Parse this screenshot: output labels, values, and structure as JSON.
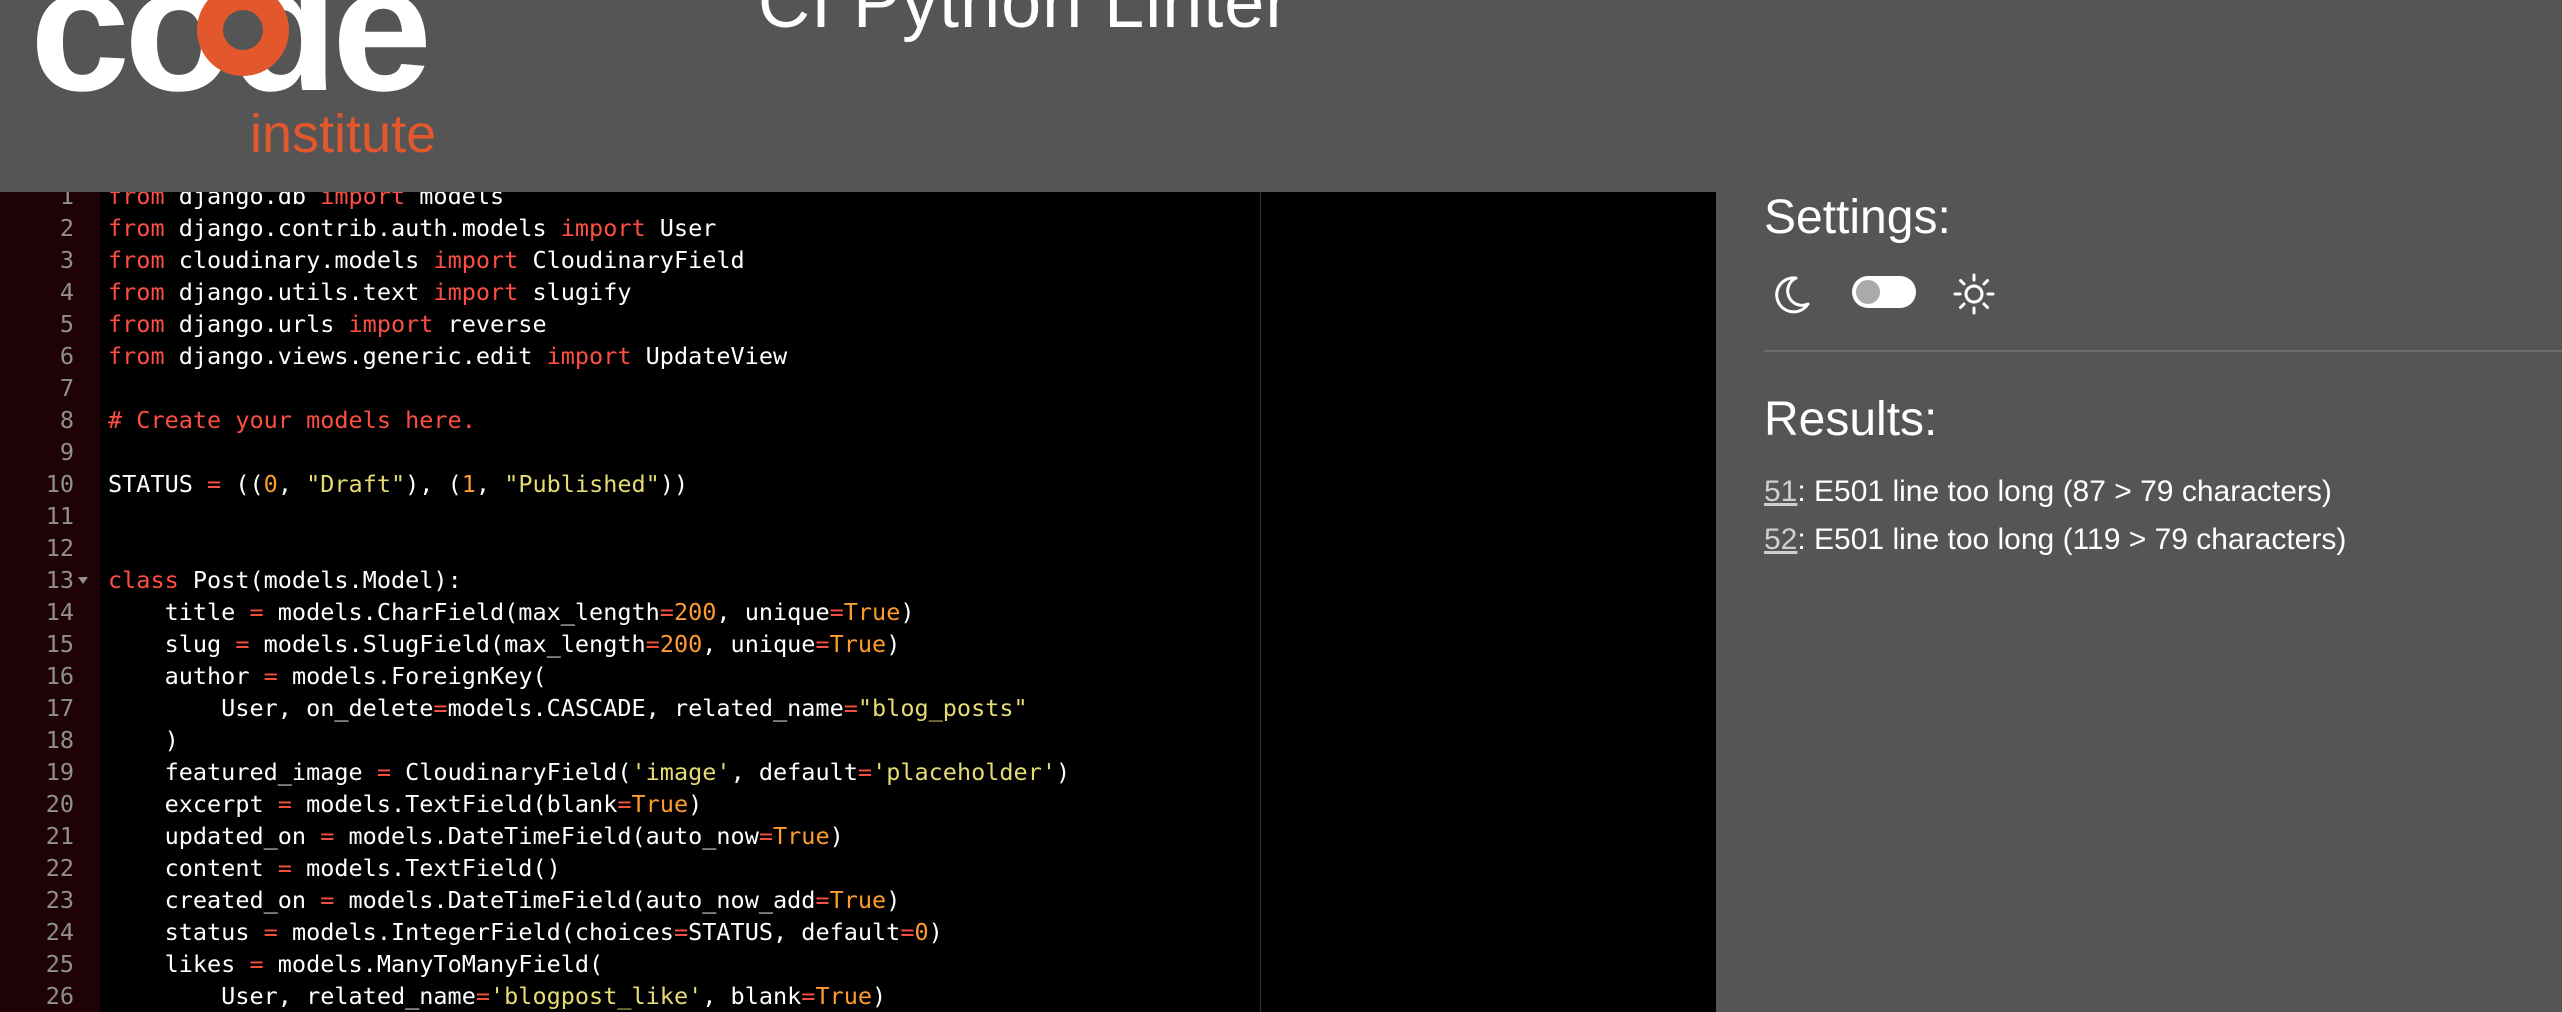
{
  "header": {
    "logo_main": "code",
    "logo_sub": "institute",
    "title": "CI Python Linter"
  },
  "editor": {
    "lines": [
      {
        "n": "1",
        "tokens": [
          [
            "kw",
            "from"
          ],
          [
            "t",
            " django.db "
          ],
          [
            "kw",
            "import"
          ],
          [
            "t",
            " models"
          ]
        ]
      },
      {
        "n": "2",
        "tokens": [
          [
            "kw",
            "from"
          ],
          [
            "t",
            " django.contrib.auth.models "
          ],
          [
            "kw",
            "import"
          ],
          [
            "t",
            " User"
          ]
        ]
      },
      {
        "n": "3",
        "tokens": [
          [
            "kw",
            "from"
          ],
          [
            "t",
            " cloudinary.models "
          ],
          [
            "kw",
            "import"
          ],
          [
            "t",
            " CloudinaryField"
          ]
        ]
      },
      {
        "n": "4",
        "tokens": [
          [
            "kw",
            "from"
          ],
          [
            "t",
            " django.utils.text "
          ],
          [
            "kw",
            "import"
          ],
          [
            "t",
            " slugify"
          ]
        ]
      },
      {
        "n": "5",
        "tokens": [
          [
            "kw",
            "from"
          ],
          [
            "t",
            " django.urls "
          ],
          [
            "kw",
            "import"
          ],
          [
            "t",
            " reverse"
          ]
        ]
      },
      {
        "n": "6",
        "tokens": [
          [
            "kw",
            "from"
          ],
          [
            "t",
            " django.views.generic.edit "
          ],
          [
            "kw",
            "import"
          ],
          [
            "t",
            " UpdateView"
          ]
        ]
      },
      {
        "n": "7",
        "tokens": []
      },
      {
        "n": "8",
        "tokens": [
          [
            "cm",
            "# Create your models here."
          ]
        ]
      },
      {
        "n": "9",
        "tokens": []
      },
      {
        "n": "10",
        "tokens": [
          [
            "t",
            "STATUS "
          ],
          [
            "op",
            "="
          ],
          [
            "t",
            " (("
          ],
          [
            "num",
            "0"
          ],
          [
            "t",
            ", "
          ],
          [
            "str",
            "\"Draft\""
          ],
          [
            "t",
            "), ("
          ],
          [
            "num",
            "1"
          ],
          [
            "t",
            ", "
          ],
          [
            "str",
            "\"Published\""
          ],
          [
            "t",
            "))"
          ]
        ]
      },
      {
        "n": "11",
        "tokens": []
      },
      {
        "n": "12",
        "tokens": []
      },
      {
        "n": "13",
        "fold": true,
        "tokens": [
          [
            "kw",
            "class"
          ],
          [
            "t",
            " Post(models.Model):"
          ]
        ]
      },
      {
        "n": "14",
        "tokens": [
          [
            "t",
            "    title "
          ],
          [
            "op",
            "="
          ],
          [
            "t",
            " models.CharField(max_length"
          ],
          [
            "op",
            "="
          ],
          [
            "num",
            "200"
          ],
          [
            "t",
            ", unique"
          ],
          [
            "op",
            "="
          ],
          [
            "num",
            "True"
          ],
          [
            "t",
            ")"
          ]
        ]
      },
      {
        "n": "15",
        "tokens": [
          [
            "t",
            "    slug "
          ],
          [
            "op",
            "="
          ],
          [
            "t",
            " models.SlugField(max_length"
          ],
          [
            "op",
            "="
          ],
          [
            "num",
            "200"
          ],
          [
            "t",
            ", unique"
          ],
          [
            "op",
            "="
          ],
          [
            "num",
            "True"
          ],
          [
            "t",
            ")"
          ]
        ]
      },
      {
        "n": "16",
        "tokens": [
          [
            "t",
            "    author "
          ],
          [
            "op",
            "="
          ],
          [
            "t",
            " models.ForeignKey("
          ]
        ]
      },
      {
        "n": "17",
        "tokens": [
          [
            "t",
            "        User, on_delete"
          ],
          [
            "op",
            "="
          ],
          [
            "t",
            "models.CASCADE, related_name"
          ],
          [
            "op",
            "="
          ],
          [
            "str",
            "\"blog_posts\""
          ]
        ]
      },
      {
        "n": "18",
        "tokens": [
          [
            "t",
            "    )"
          ]
        ]
      },
      {
        "n": "19",
        "tokens": [
          [
            "t",
            "    featured_image "
          ],
          [
            "op",
            "="
          ],
          [
            "t",
            " CloudinaryField("
          ],
          [
            "str",
            "'image'"
          ],
          [
            "t",
            ", default"
          ],
          [
            "op",
            "="
          ],
          [
            "str",
            "'placeholder'"
          ],
          [
            "t",
            ")"
          ]
        ]
      },
      {
        "n": "20",
        "tokens": [
          [
            "t",
            "    excerpt "
          ],
          [
            "op",
            "="
          ],
          [
            "t",
            " models.TextField(blank"
          ],
          [
            "op",
            "="
          ],
          [
            "num",
            "True"
          ],
          [
            "t",
            ")"
          ]
        ]
      },
      {
        "n": "21",
        "tokens": [
          [
            "t",
            "    updated_on "
          ],
          [
            "op",
            "="
          ],
          [
            "t",
            " models.DateTimeField(auto_now"
          ],
          [
            "op",
            "="
          ],
          [
            "num",
            "True"
          ],
          [
            "t",
            ")"
          ]
        ]
      },
      {
        "n": "22",
        "tokens": [
          [
            "t",
            "    content "
          ],
          [
            "op",
            "="
          ],
          [
            "t",
            " models.TextField()"
          ]
        ]
      },
      {
        "n": "23",
        "tokens": [
          [
            "t",
            "    created_on "
          ],
          [
            "op",
            "="
          ],
          [
            "t",
            " models.DateTimeField(auto_now_add"
          ],
          [
            "op",
            "="
          ],
          [
            "num",
            "True"
          ],
          [
            "t",
            ")"
          ]
        ]
      },
      {
        "n": "24",
        "tokens": [
          [
            "t",
            "    status "
          ],
          [
            "op",
            "="
          ],
          [
            "t",
            " models.IntegerField(choices"
          ],
          [
            "op",
            "="
          ],
          [
            "t",
            "STATUS, default"
          ],
          [
            "op",
            "="
          ],
          [
            "num",
            "0"
          ],
          [
            "t",
            ")"
          ]
        ]
      },
      {
        "n": "25",
        "tokens": [
          [
            "t",
            "    likes "
          ],
          [
            "op",
            "="
          ],
          [
            "t",
            " models.ManyToManyField("
          ]
        ]
      },
      {
        "n": "26",
        "tokens": [
          [
            "t",
            "        User, related_name"
          ],
          [
            "op",
            "="
          ],
          [
            "str",
            "'blogpost_like'"
          ],
          [
            "t",
            ", blank"
          ],
          [
            "op",
            "="
          ],
          [
            "num",
            "True"
          ],
          [
            "t",
            ")"
          ]
        ]
      }
    ]
  },
  "settings": {
    "title": "Settings:",
    "dark_icon": "moon-icon",
    "light_icon": "sun-icon",
    "toggle_on": false
  },
  "results": {
    "title": "Results:",
    "items": [
      {
        "line": "51",
        "message": ": E501 line too long (87 > 79 characters)"
      },
      {
        "line": "52",
        "message": ": E501 line too long (119 > 79 characters)"
      }
    ]
  },
  "colors": {
    "background": "#555555",
    "editor_bg": "#000000",
    "gutter_bg": "#1f0208",
    "keyword": "#fd4e43",
    "string": "#e6db74",
    "number": "#fd9b2f",
    "logo_orange": "#e2572b"
  }
}
